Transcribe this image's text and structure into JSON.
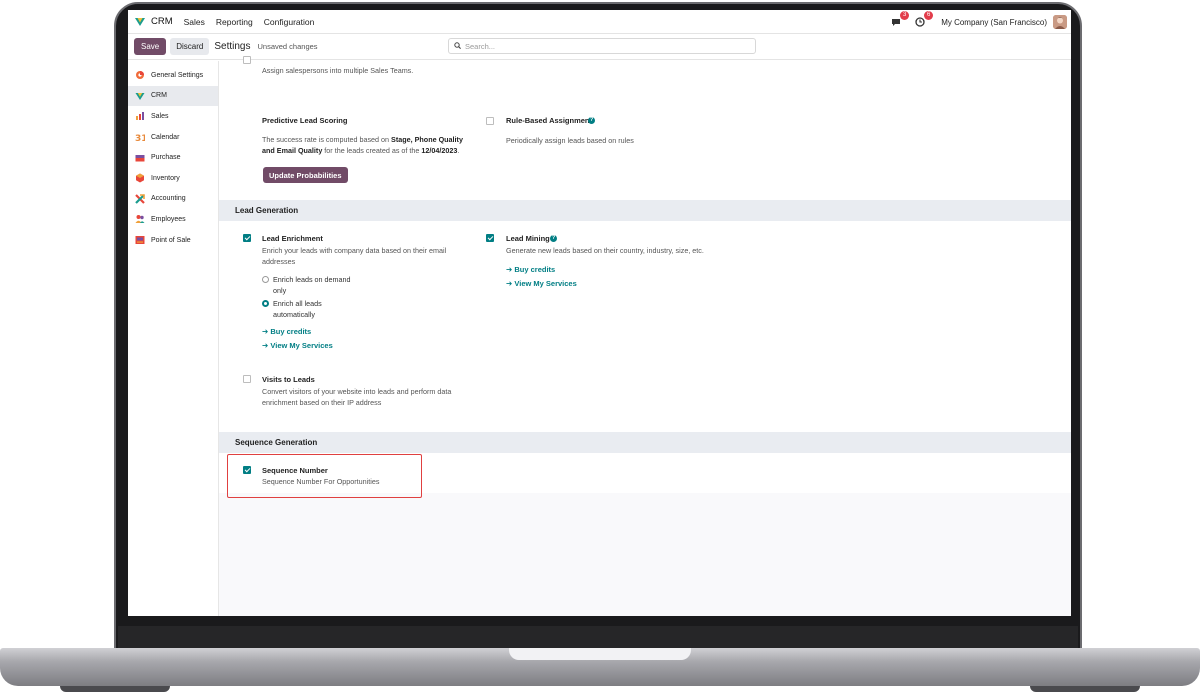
{
  "navbar": {
    "app_name": "CRM",
    "menu": [
      "Sales",
      "Reporting",
      "Configuration"
    ],
    "messages_count": "3",
    "activities_count": "6",
    "company": "My Company (San Francisco)"
  },
  "control_panel": {
    "save_label": "Save",
    "discard_label": "Discard",
    "title": "Settings",
    "unsaved": "Unsaved changes",
    "search_placeholder": "Search..."
  },
  "sidebar": {
    "items": [
      {
        "label": "General Settings",
        "icon": "general-settings-icon",
        "active": false
      },
      {
        "label": "CRM",
        "icon": "crm-icon",
        "active": true
      },
      {
        "label": "Sales",
        "icon": "sales-icon",
        "active": false
      },
      {
        "label": "Calendar",
        "icon": "calendar-icon",
        "active": false
      },
      {
        "label": "Purchase",
        "icon": "purchase-icon",
        "active": false
      },
      {
        "label": "Inventory",
        "icon": "inventory-icon",
        "active": false
      },
      {
        "label": "Accounting",
        "icon": "accounting-icon",
        "active": false
      },
      {
        "label": "Employees",
        "icon": "employees-icon",
        "active": false
      },
      {
        "label": "Point of Sale",
        "icon": "point-of-sale-icon",
        "active": false
      }
    ]
  },
  "content": {
    "assign_teams_desc": "Assign salespersons into multiple Sales Teams.",
    "predictive": {
      "title": "Predictive Lead Scoring",
      "desc_1": "The success rate is computed based on ",
      "desc_bold_1": "Stage, Phone Quality",
      "desc_bold_2": "and Email Quality",
      "desc_2": " for the leads created as of the ",
      "desc_date": "12/04/2023",
      "desc_end": ".",
      "button": "Update Probabilities"
    },
    "rule_based": {
      "title": "Rule-Based Assignment",
      "desc": "Periodically assign leads based on rules",
      "checked": false
    },
    "lead_generation": {
      "header": "Lead Generation",
      "enrichment": {
        "title": "Lead Enrichment",
        "desc_1": "Enrich your leads with company data based on their email",
        "desc_2": "addresses",
        "checked": true,
        "option_1a": "Enrich leads on demand",
        "option_1b": "only",
        "option_2a": "Enrich all leads",
        "option_2b": "automatically",
        "selected_option": "Enrich all leads automatically",
        "buy_credits": "➔ Buy credits",
        "view_services": "➔ View My Services"
      },
      "mining": {
        "title": "Lead Mining",
        "desc": "Generate new leads based on their country, industry, size, etc.",
        "checked": true,
        "buy_credits": "➔ Buy credits",
        "view_services": "➔ View My Services"
      },
      "visits": {
        "title": "Visits to Leads",
        "desc_1": "Convert visitors of your website into leads and perform data",
        "desc_2": "enrichment based on their IP address",
        "checked": false
      }
    },
    "sequence_generation": {
      "header": "Sequence Generation",
      "sequence": {
        "title": "Sequence Number",
        "desc": "Sequence Number For Opportunities",
        "checked": true
      }
    }
  },
  "colors": {
    "brand": "#714b67",
    "accent": "#017e84",
    "highlight": "#e04040",
    "badge": "#e23d4b"
  }
}
